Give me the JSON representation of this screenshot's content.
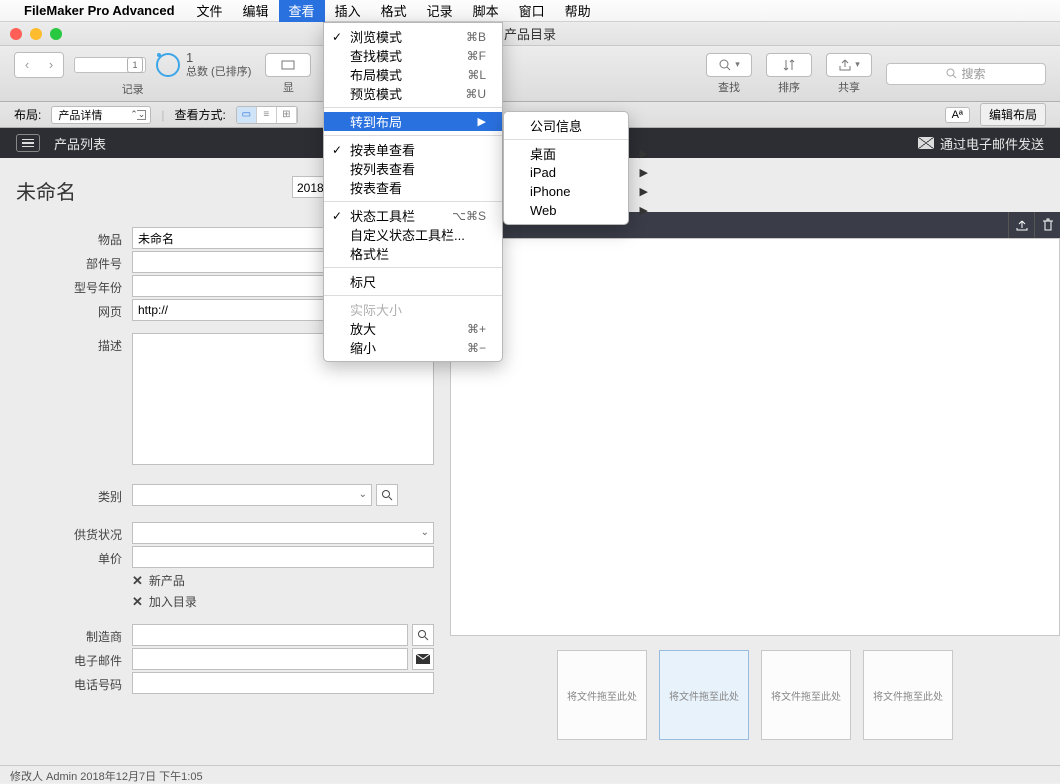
{
  "menubar": {
    "app_name": "FileMaker Pro Advanced",
    "items": [
      "文件",
      "编辑",
      "查看",
      "插入",
      "格式",
      "记录",
      "脚本",
      "窗口",
      "帮助"
    ],
    "active_index": 2
  },
  "window": {
    "title": "产品目录"
  },
  "toolbar": {
    "slider_value": "1",
    "record_current": "1",
    "record_total_label": "总数 (已排序)",
    "btn_records": "记录",
    "btn_show": "显",
    "btn_record_single": "记录",
    "btn_find": "查找",
    "btn_sort": "排序",
    "btn_share": "共享",
    "search_placeholder": "搜索"
  },
  "subbar": {
    "layout_label": "布局:",
    "layout_value": "产品详情",
    "viewmode_label": "查看方式:",
    "edit_layout": "编辑布局",
    "aa_label": "Aª"
  },
  "blackbar": {
    "title": "产品列表",
    "email_btn": "通过电子邮件发送"
  },
  "record": {
    "title": "未命名",
    "date_value": "2018年12月7日",
    "labels": {
      "item": "物品",
      "part": "部件号",
      "model_year": "型号年份",
      "web": "网页",
      "description": "描述",
      "category": "类别",
      "availability": "供货状况",
      "price": "单价",
      "new_product": "新产品",
      "add_catalog": "加入目录",
      "manufacturer": "制造商",
      "email": "电子邮件",
      "phone": "电话号码"
    },
    "values": {
      "item": "未命名",
      "part": "",
      "model_year": "",
      "web": "http://",
      "description": "",
      "category": "",
      "availability": "",
      "price": "",
      "manufacturer": "",
      "email": "",
      "phone": ""
    },
    "checkbox": {
      "new_product": true,
      "add_catalog": true
    }
  },
  "dropzones": {
    "label": "将文件拖至此处",
    "count": 4,
    "active_index": 1
  },
  "status": {
    "text": "修改人 Admin 2018年12月7日  下午1:05"
  },
  "menu_view": {
    "items": [
      {
        "label": "浏览模式",
        "shortcut": "⌘B",
        "checked": true
      },
      {
        "label": "查找模式",
        "shortcut": "⌘F"
      },
      {
        "label": "布局模式",
        "shortcut": "⌘L"
      },
      {
        "label": "预览模式",
        "shortcut": "⌘U"
      },
      {
        "sep": true
      },
      {
        "label": "转到布局",
        "submenu": true,
        "highlighted": true
      },
      {
        "sep": true
      },
      {
        "label": "按表单查看",
        "checked": true
      },
      {
        "label": "按列表查看"
      },
      {
        "label": "按表查看"
      },
      {
        "sep": true
      },
      {
        "label": "状态工具栏",
        "shortcut": "⌥⌘S",
        "checked": true
      },
      {
        "label": "自定义状态工具栏..."
      },
      {
        "label": "格式栏"
      },
      {
        "sep": true
      },
      {
        "label": "标尺"
      },
      {
        "sep": true
      },
      {
        "label": "实际大小",
        "disabled": true
      },
      {
        "label": "放大",
        "shortcut": "⌘+"
      },
      {
        "label": "缩小",
        "shortcut": "⌘−"
      }
    ]
  },
  "submenu_goto": {
    "items": [
      {
        "label": "公司信息"
      },
      {
        "sep": true
      },
      {
        "label": "桌面",
        "submenu": true
      },
      {
        "label": "iPad",
        "submenu": true
      },
      {
        "label": "iPhone",
        "submenu": true
      },
      {
        "label": "Web",
        "submenu": true
      }
    ]
  }
}
